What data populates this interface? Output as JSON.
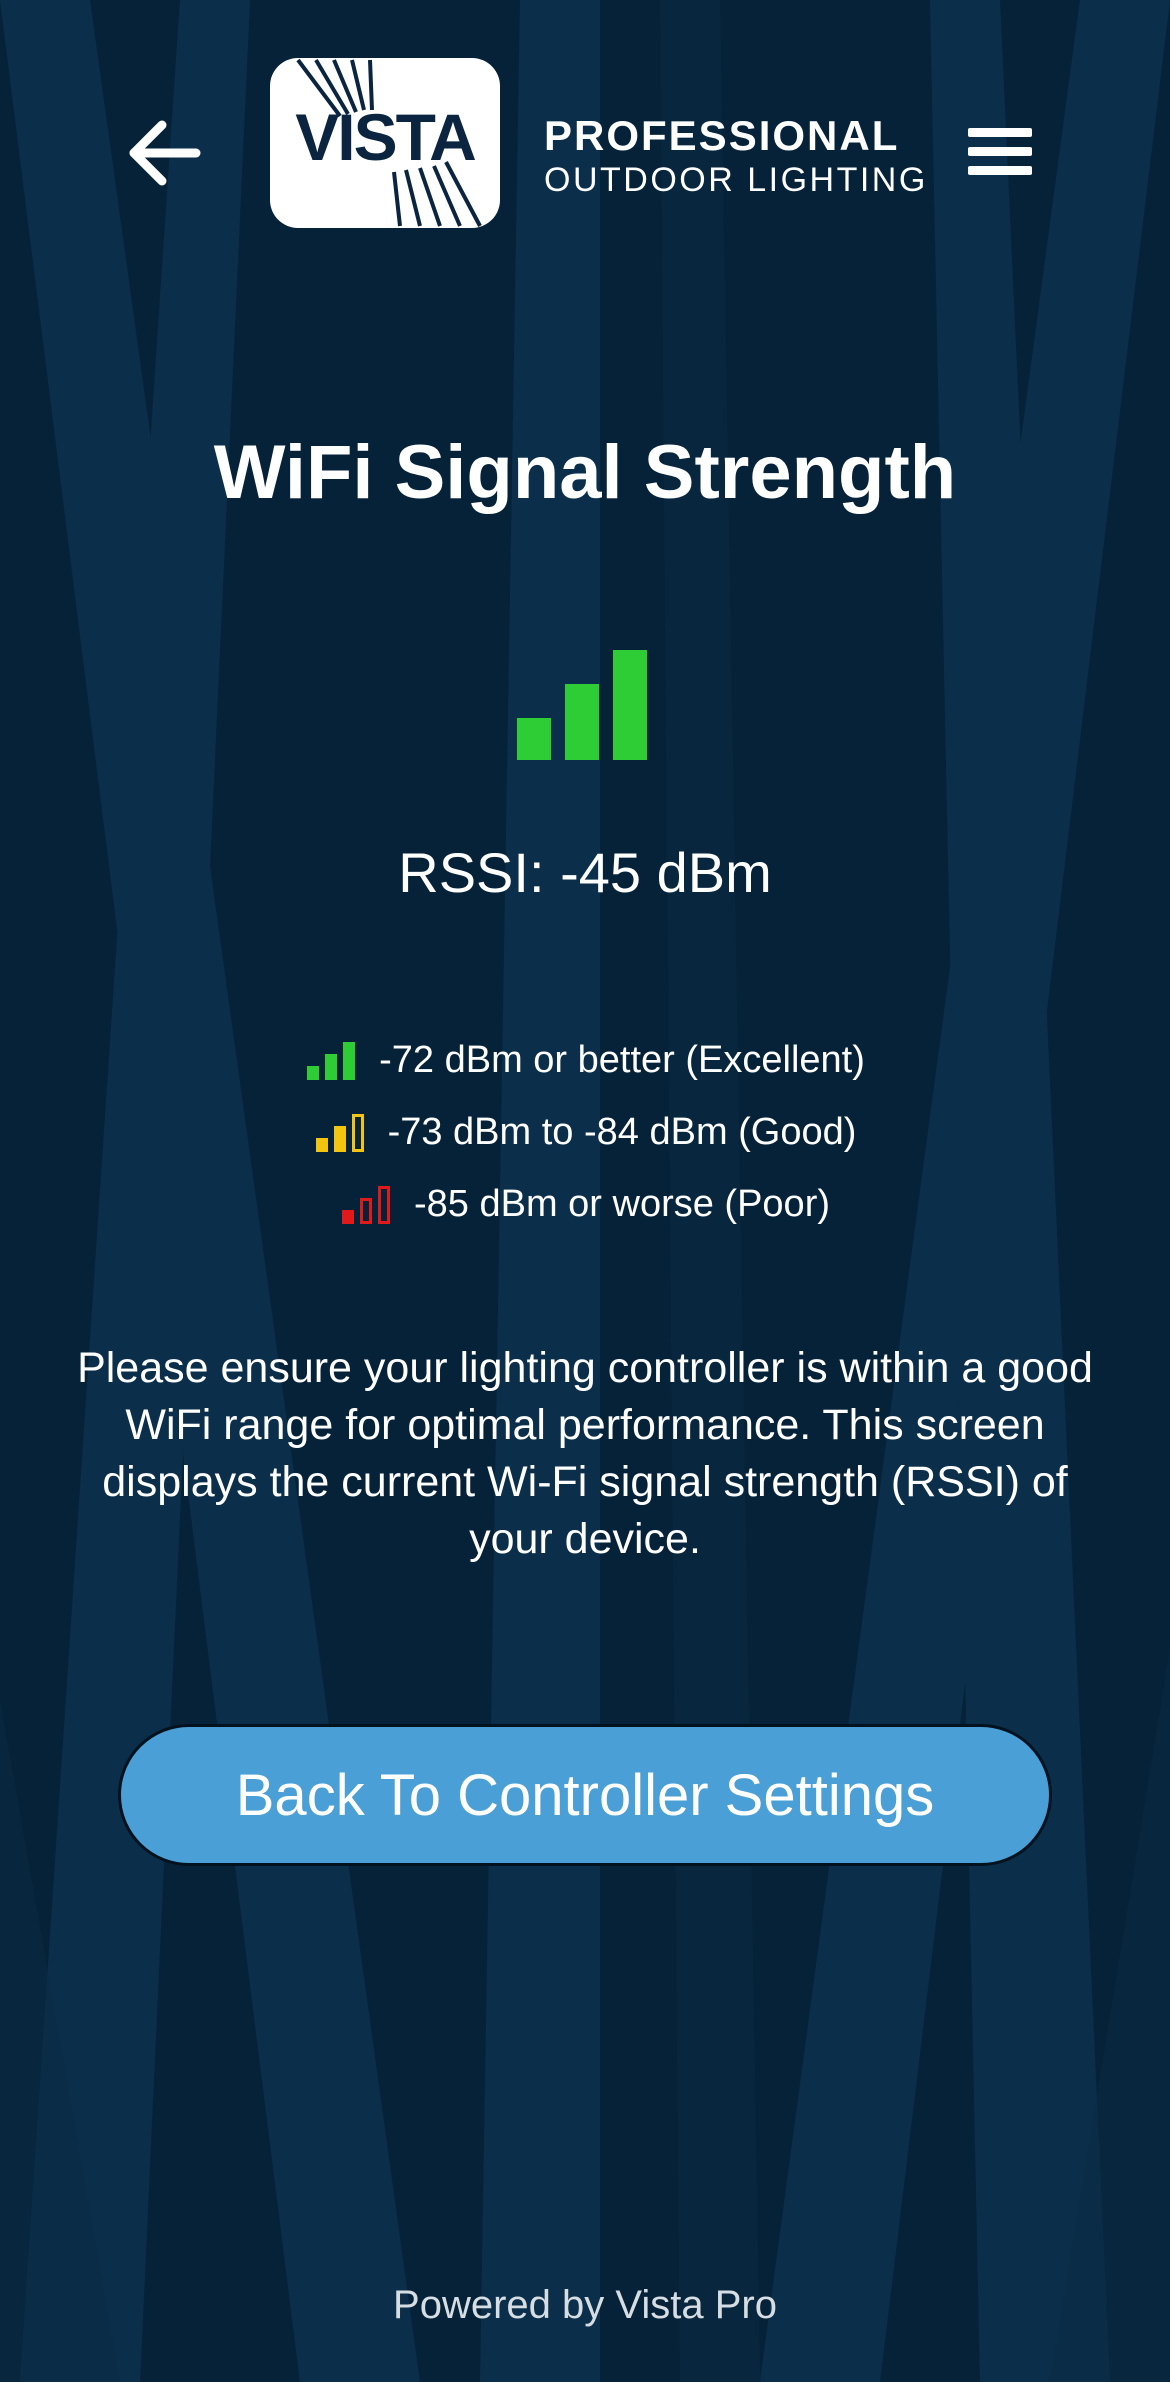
{
  "header": {
    "logo_text": "VISTA",
    "brand_line1": "PROFESSIONAL",
    "brand_line2": "OUTDOOR LIGHTING",
    "back_icon": "arrow-left-icon",
    "menu_icon": "hamburger-menu-icon"
  },
  "main": {
    "title": "WiFi Signal Strength",
    "signal_icon": "signal-bars-icon",
    "rssi_text": "RSSI: -45 dBm",
    "legend": [
      {
        "label": "-72 dBm or better (Excellent)",
        "color": "#2ecc35",
        "icon": "signal-excellent-icon"
      },
      {
        "label": "-73 dBm to -84 dBm (Good)",
        "color": "#f2c511",
        "icon": "signal-good-icon"
      },
      {
        "label": "-85 dBm or worse (Poor)",
        "color": "#e0191b",
        "icon": "signal-poor-icon"
      }
    ],
    "description": "Please ensure your lighting controller is within a good WiFi range for optimal performance. This screen displays the current Wi-Fi signal strength (RSSI) of your device.",
    "back_button_label": "Back To Controller Settings"
  },
  "footer": {
    "text": "Powered by Vista Pro"
  },
  "colors": {
    "background": "#062239",
    "accent_button": "#4aa0d6",
    "excellent": "#2ecc35",
    "good": "#f2c511",
    "poor": "#e0191b"
  }
}
